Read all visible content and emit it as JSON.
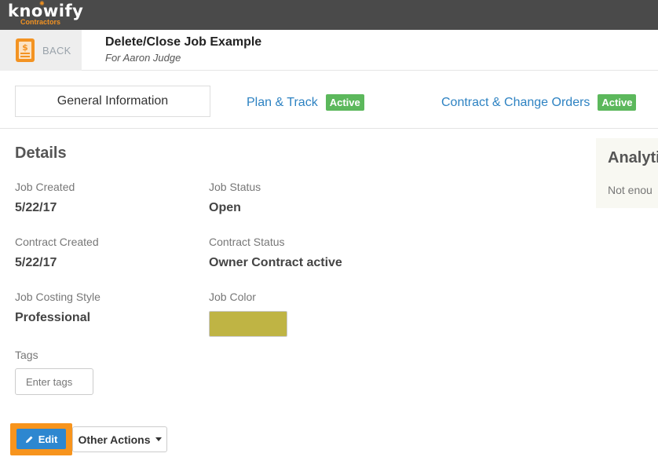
{
  "brand": {
    "name": "knowify",
    "tagline": "Contractors",
    "accent": "#f39322"
  },
  "header": {
    "back_label": "BACK",
    "title": "Delete/Close Job Example",
    "subtitle": "For Aaron Judge"
  },
  "tabs": {
    "general": "General Information",
    "plan_track": "Plan & Track",
    "plan_track_badge": "Active",
    "contract": "Contract & Change Orders",
    "contract_badge": "Active"
  },
  "details": {
    "title": "Details",
    "job_created_label": "Job Created",
    "job_created_value": "5/22/17",
    "job_status_label": "Job Status",
    "job_status_value": "Open",
    "contract_created_label": "Contract Created",
    "contract_created_value": "5/22/17",
    "contract_status_label": "Contract Status",
    "contract_status_value": "Owner Contract active",
    "costing_style_label": "Job Costing Style",
    "costing_style_value": "Professional",
    "job_color_label": "Job Color",
    "job_color_value": "#bfb444",
    "tags_label": "Tags",
    "tags_placeholder": "Enter tags"
  },
  "actions": {
    "edit_label": "Edit",
    "other_actions_label": "Other Actions"
  },
  "analytics": {
    "title": "Analyti",
    "text": "Not enou"
  },
  "colors": {
    "topbar": "#4a4a4a",
    "link": "#2d82c2",
    "active_badge": "#5cb85c",
    "edit_button": "#2d87d0",
    "highlight": "#f7941d"
  }
}
